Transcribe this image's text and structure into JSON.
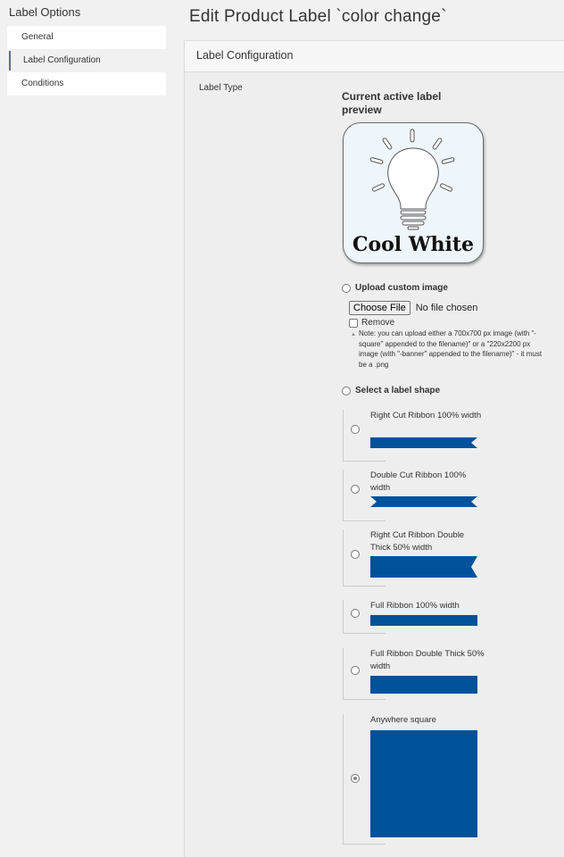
{
  "sidebar": {
    "title": "Label Options",
    "items": [
      {
        "label": "General",
        "active": false
      },
      {
        "label": "Label Configuration",
        "active": true
      },
      {
        "label": "Conditions",
        "active": false
      }
    ]
  },
  "page": {
    "title": "Edit Product Label `color change`"
  },
  "panel": {
    "header": "Label Configuration",
    "label_type_label": "Label Type",
    "preview_title": "Current active label preview",
    "preview_text": "Cool White",
    "upload_option_label": "Upload custom image",
    "file_button_label": "Choose File",
    "file_status": "No file chosen",
    "remove_label": "Remove",
    "note": "Note: you can upload either a 700x700 px image (with \"-square\" appended to the filename)\" or a \"220x2200 px image (with \"-banner\" appended to the filename)\" - it must be a .png",
    "shape_option_label": "Select a label shape",
    "shapes": [
      {
        "label": "Right Cut Ribbon 100% width",
        "selected": false
      },
      {
        "label": "Double Cut Ribbon 100% width",
        "selected": false
      },
      {
        "label": "Right Cut Ribbon Double Thick 50% width",
        "selected": false
      },
      {
        "label": "Full Ribbon 100% width",
        "selected": false
      },
      {
        "label": "Full Ribbon Double Thick 50% width",
        "selected": false
      },
      {
        "label": "Anywhere square",
        "selected": true
      }
    ]
  },
  "colors": {
    "accent_blue": "#00529b",
    "background": "#f1f1f1"
  }
}
